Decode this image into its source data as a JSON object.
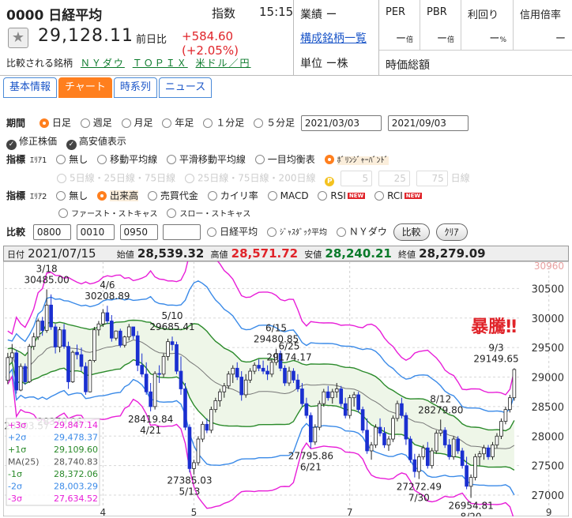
{
  "header": {
    "code_name": "0000 日経平均",
    "kind": "指数",
    "time": "15:15",
    "star": "★",
    "price": "29,128.11",
    "change_label": "前日比",
    "change": "+584.60 (+2.05%)",
    "compare_label": "比較される銘柄",
    "compare_links": [
      "ＮＹダウ",
      "ＴＯＰＩＸ",
      "米ドル／円"
    ],
    "gyoseki": "業績 ー",
    "kosei_link": "構成銘柄一覧",
    "tani": "単位 ー株",
    "stats": [
      {
        "label": "PER",
        "value": "ー",
        "unit": "倍"
      },
      {
        "label": "PBR",
        "value": "ー",
        "unit": "倍"
      },
      {
        "label": "利回り",
        "value": "ー",
        "unit": "%"
      },
      {
        "label": "信用倍率",
        "value": "ー",
        "unit": ""
      }
    ],
    "jika": "時価総額"
  },
  "tabs": [
    "基本情報",
    "チャート",
    "時系列",
    "ニュース"
  ],
  "controls": {
    "period_label": "期間",
    "periods": [
      "日足",
      "週足",
      "月足",
      "年足",
      "１分足",
      "５分足"
    ],
    "date_from": "2021/03/03",
    "date_to": "2021/09/03",
    "adj_label": "修正株価",
    "hl_label": "高安値表示",
    "ind_label": "指標",
    "area1_label": "ｴﾘｱ1",
    "area1_opts": [
      "無し",
      "移動平均線",
      "平滑移動平均線",
      "一目均衡表",
      "ﾎﾞﾘﾝｼﾞｬｰﾊﾞﾝﾄﾞ"
    ],
    "ma_opts": [
      "5日線・25日線・75日線",
      "25日線・75日線・200日線"
    ],
    "p_icon": "P",
    "ma_vals": [
      "5",
      "25",
      "75"
    ],
    "ma_unit": "日線",
    "area2_label": "ｴﾘｱ2",
    "area2_opts": [
      "無し",
      "出来高",
      "売買代金",
      "カイリ率",
      "MACD",
      "RSI",
      "RCI"
    ],
    "new_badge": "NEW",
    "area2_opts2": [
      "ファースト・ストキャス",
      "スロー・ストキャス"
    ],
    "cmp_label": "比較",
    "cmp_codes": [
      "0800",
      "0010",
      "0950",
      ""
    ],
    "cmp_opts": [
      "日経平均",
      "ｼﾞｬｽﾀﾞｯｸ平均",
      "ＮＹダウ"
    ],
    "btn_compare": "比較",
    "btn_clear": "ｸﾘｱ"
  },
  "chart_header": {
    "date_label": "日付",
    "date": "2021/07/15",
    "open_label": "始値",
    "open": "28,539.32",
    "high_label": "高値",
    "high": "28,571.72",
    "low_label": "安値",
    "low": "28,240.21",
    "close_label": "終値",
    "close": "28,279.09"
  },
  "colors": {
    "up_candle": "#ffffff",
    "down_candle": "#1a2fd0",
    "sigma1": "#2a8a2a",
    "sigma2": "#3a8ae8",
    "sigma3": "#e81ed8",
    "ma25": "#777777",
    "band_fill": "#eef6e8",
    "accent": "#ff7f1e"
  },
  "chart_data": {
    "type": "candlestick",
    "ylim": [
      26800,
      30960
    ],
    "y_ticks": [
      27000,
      27500,
      28000,
      28500,
      29000,
      29500,
      30000,
      30500
    ],
    "y_top_label": "30960",
    "x_ticks": [
      {
        "day": 22,
        "label": "4"
      },
      {
        "day": 43,
        "label": "5"
      },
      {
        "day": 79,
        "label": "7"
      },
      {
        "day": 125,
        "label": "9"
      }
    ],
    "candles": [
      [
        28944,
        29410,
        28880,
        29330
      ],
      [
        29330,
        29560,
        29250,
        29410
      ],
      [
        29410,
        29460,
        28720,
        28780
      ],
      [
        28780,
        29230,
        28760,
        29180
      ],
      [
        29180,
        29230,
        28870,
        28920
      ],
      [
        28920,
        29560,
        28900,
        29520
      ],
      [
        29520,
        29750,
        29460,
        29680
      ],
      [
        29680,
        29990,
        29630,
        29950
      ],
      [
        29950,
        30020,
        29700,
        29790
      ],
      [
        29790,
        30485,
        29750,
        30220
      ],
      [
        30220,
        30400,
        29800,
        29850
      ],
      [
        29850,
        29900,
        29400,
        29510
      ],
      [
        29510,
        29850,
        29420,
        29800
      ],
      [
        29800,
        29900,
        29480,
        29520
      ],
      [
        29520,
        29600,
        28800,
        28920
      ],
      [
        28920,
        29450,
        28900,
        29420
      ],
      [
        29420,
        29550,
        29300,
        29380
      ],
      [
        29380,
        29500,
        29100,
        29180
      ],
      [
        29180,
        29250,
        28700,
        28750
      ],
      [
        28750,
        29300,
        28740,
        29280
      ],
      [
        29280,
        29850,
        29250,
        29800
      ],
      [
        29800,
        29950,
        29700,
        29900
      ],
      [
        29900,
        30150,
        29850,
        30090
      ],
      [
        30090,
        30208,
        29900,
        29950
      ],
      [
        29950,
        30050,
        29600,
        29660
      ],
      [
        29660,
        29790,
        29620,
        29780
      ],
      [
        29780,
        29820,
        29500,
        29540
      ],
      [
        29540,
        29700,
        29500,
        29680
      ],
      [
        29680,
        29900,
        29620,
        29850
      ],
      [
        29850,
        29850,
        29640,
        29700
      ],
      [
        29700,
        29780,
        29100,
        29200
      ],
      [
        29200,
        29400,
        29000,
        29050
      ],
      [
        29050,
        29250,
        28700,
        28750
      ],
      [
        28750,
        28900,
        28420,
        28500
      ],
      [
        28500,
        29100,
        28450,
        29060
      ],
      [
        29060,
        29200,
        28900,
        29050
      ],
      [
        29050,
        29400,
        29000,
        29350
      ],
      [
        29350,
        29650,
        29280,
        29600
      ],
      [
        29600,
        29686,
        29450,
        29550
      ],
      [
        29550,
        29600,
        29050,
        29100
      ],
      [
        29100,
        29350,
        28700,
        28800
      ],
      [
        28800,
        28900,
        28100,
        28150
      ],
      [
        28150,
        28200,
        27385,
        27450
      ],
      [
        27450,
        27600,
        27350,
        27550
      ],
      [
        27550,
        28000,
        27500,
        27950
      ],
      [
        27950,
        28250,
        27900,
        28200
      ],
      [
        28200,
        28300,
        28050,
        28100
      ],
      [
        28100,
        28500,
        28050,
        28450
      ],
      [
        28450,
        28650,
        28400,
        28600
      ],
      [
        28600,
        28800,
        28500,
        28750
      ],
      [
        28750,
        28900,
        28650,
        28850
      ],
      [
        28850,
        29100,
        28800,
        29050
      ],
      [
        29050,
        29200,
        28900,
        29150
      ],
      [
        29150,
        29250,
        28950,
        29000
      ],
      [
        29000,
        29100,
        28600,
        28700
      ],
      [
        28700,
        29050,
        28650,
        28950
      ],
      [
        28950,
        29150,
        28900,
        29100
      ],
      [
        29100,
        29250,
        29050,
        29200
      ],
      [
        29200,
        29300,
        29100,
        29150
      ],
      [
        29150,
        29280,
        29050,
        29100
      ],
      [
        29100,
        29200,
        28950,
        29050
      ],
      [
        29050,
        29300,
        29000,
        29250
      ],
      [
        29250,
        29480,
        29200,
        29400
      ],
      [
        29400,
        29450,
        29100,
        29150
      ],
      [
        29150,
        29200,
        28850,
        28900
      ],
      [
        28900,
        29174,
        28850,
        29100
      ],
      [
        29100,
        29150,
        28900,
        28950
      ],
      [
        28950,
        29050,
        28750,
        28800
      ],
      [
        28800,
        28900,
        28500,
        28550
      ],
      [
        28550,
        28650,
        28300,
        28350
      ],
      [
        28350,
        28400,
        27796,
        27900
      ],
      [
        27900,
        28200,
        27850,
        28150
      ],
      [
        28150,
        28600,
        28100,
        28550
      ],
      [
        28550,
        28800,
        28500,
        28750
      ],
      [
        28750,
        28850,
        28600,
        28650
      ],
      [
        28650,
        28800,
        28550,
        28750
      ],
      [
        28750,
        28900,
        28650,
        28800
      ],
      [
        28800,
        28850,
        28500,
        28550
      ],
      [
        28550,
        28650,
        28300,
        28350
      ],
      [
        28350,
        28700,
        28300,
        28650
      ],
      [
        28650,
        28750,
        28500,
        28700
      ],
      [
        28700,
        28750,
        28400,
        28450
      ],
      [
        28450,
        28500,
        28050,
        28100
      ],
      [
        28100,
        28300,
        27700,
        27750
      ],
      [
        27750,
        27900,
        27600,
        27850
      ],
      [
        27850,
        28200,
        27800,
        28150
      ],
      [
        28150,
        28300,
        28000,
        28050
      ],
      [
        28050,
        28150,
        27800,
        27850
      ],
      [
        27850,
        28000,
        27750,
        27950
      ],
      [
        27950,
        28350,
        27900,
        28300
      ],
      [
        28300,
        28600,
        28250,
        28550
      ],
      [
        28550,
        28650,
        28300,
        28350
      ],
      [
        28350,
        28400,
        27850,
        27950
      ],
      [
        27950,
        28000,
        27550,
        27600
      ],
      [
        27600,
        27700,
        27300,
        27400
      ],
      [
        27400,
        27700,
        27273,
        27650
      ],
      [
        27650,
        27850,
        27600,
        27800
      ],
      [
        27800,
        27900,
        27450,
        27500
      ],
      [
        27500,
        27800,
        27450,
        27750
      ],
      [
        27750,
        28100,
        27700,
        28050
      ],
      [
        28050,
        28280,
        28000,
        28100
      ],
      [
        28100,
        28150,
        27800,
        27850
      ],
      [
        27850,
        27950,
        27600,
        27650
      ],
      [
        27650,
        28000,
        27600,
        27950
      ],
      [
        27950,
        28000,
        27700,
        27750
      ],
      [
        27750,
        27800,
        27450,
        27500
      ],
      [
        27500,
        27650,
        27100,
        27150
      ],
      [
        27150,
        27350,
        26954,
        27300
      ],
      [
        27300,
        27700,
        27250,
        27650
      ],
      [
        27650,
        27750,
        27500,
        27700
      ],
      [
        27700,
        27850,
        27600,
        27800
      ],
      [
        27800,
        27850,
        27600,
        27650
      ],
      [
        27650,
        27900,
        27600,
        27850
      ],
      [
        27850,
        28050,
        27800,
        28000
      ],
      [
        28000,
        28300,
        27950,
        28250
      ],
      [
        28250,
        28500,
        28200,
        28450
      ],
      [
        28450,
        28700,
        28400,
        28650
      ],
      [
        28650,
        29150,
        28600,
        29128
      ]
    ],
    "annotations": [
      {
        "text": "3/18",
        "day": 9,
        "y": 30485,
        "pos": "above"
      },
      {
        "text": "30485.00",
        "day": 9,
        "y": 30485,
        "pos": "above2"
      },
      {
        "text": "4/6",
        "day": 23,
        "y": 30208,
        "pos": "above"
      },
      {
        "text": "30208.89",
        "day": 23,
        "y": 30208,
        "pos": "above2"
      },
      {
        "text": "5/10",
        "day": 38,
        "y": 29686,
        "pos": "above"
      },
      {
        "text": "29685.41",
        "day": 38,
        "y": 29686,
        "pos": "above2"
      },
      {
        "text": "6/15",
        "day": 62,
        "y": 29480,
        "pos": "above"
      },
      {
        "text": "29480.85",
        "day": 62,
        "y": 29480,
        "pos": "above2"
      },
      {
        "text": "6/25",
        "day": 65,
        "y": 29174,
        "pos": "above"
      },
      {
        "text": "29174.17",
        "day": 65,
        "y": 29174,
        "pos": "above2"
      },
      {
        "text": "28419.84",
        "day": 33,
        "y": 28420,
        "pos": "below"
      },
      {
        "text": "4/21",
        "day": 33,
        "y": 28420,
        "pos": "below2"
      },
      {
        "text": "28379.06",
        "day": 12,
        "y": 28379,
        "pos": "below"
      },
      {
        "text": "27385.03",
        "day": 42,
        "y": 27385,
        "pos": "below"
      },
      {
        "text": "5/13",
        "day": 42,
        "y": 27385,
        "pos": "below2"
      },
      {
        "text": "27795.86",
        "day": 70,
        "y": 27796,
        "pos": "below"
      },
      {
        "text": "6/21",
        "day": 70,
        "y": 27796,
        "pos": "below2"
      },
      {
        "text": "8/12",
        "day": 100,
        "y": 28280,
        "pos": "above"
      },
      {
        "text": "28279.80",
        "day": 100,
        "y": 28280,
        "pos": "above2"
      },
      {
        "text": "27272.49",
        "day": 95,
        "y": 27273,
        "pos": "below"
      },
      {
        "text": "7/30",
        "day": 95,
        "y": 27273,
        "pos": "below2"
      },
      {
        "text": "26954.81",
        "day": 107,
        "y": 26954,
        "pos": "below"
      },
      {
        "text": "8/20",
        "day": 107,
        "y": 26954,
        "pos": "below2"
      },
      {
        "text": "9/3",
        "day": 125,
        "y": 29150,
        "pos": "above"
      },
      {
        "text": "29149.65",
        "day": 125,
        "y": 29150,
        "pos": "above2"
      },
      {
        "text": "28303.57",
        "day": 0,
        "y": 28304,
        "pos": "below"
      }
    ],
    "headline": "暴騰‼",
    "legend": [
      {
        "name": "+3σ",
        "value": "29,847.14",
        "color": "#e81ed8"
      },
      {
        "name": "+2σ",
        "value": "29,478.37",
        "color": "#3a8ae8"
      },
      {
        "name": "+1σ",
        "value": "29,109.60",
        "color": "#2a8a2a"
      },
      {
        "name": "MA(25)",
        "value": "28,740.83",
        "color": "#555555"
      },
      {
        "name": "-1σ",
        "value": "28,372.06",
        "color": "#2a8a2a"
      },
      {
        "name": "-2σ",
        "value": "28,003.29",
        "color": "#3a8ae8"
      },
      {
        "name": "-3σ",
        "value": "27,634.52",
        "color": "#e81ed8"
      }
    ]
  }
}
